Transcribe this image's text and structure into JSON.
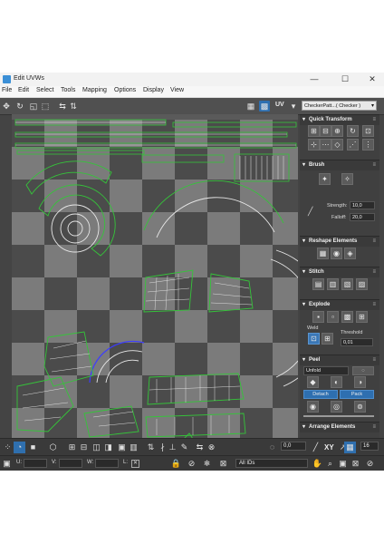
{
  "window": {
    "title": "Edit UVWs",
    "controls": {
      "minimize": "—",
      "maximize": "☐",
      "close": "✕"
    }
  },
  "menu": [
    "File",
    "Edit",
    "Select",
    "Tools",
    "Mapping",
    "Options",
    "Display",
    "View"
  ],
  "toolbar": {
    "uv_label": "UV",
    "texture_dropdown": "CheckerPatt...( Checker )"
  },
  "panels": {
    "quick_transform": {
      "title": "Quick Transform"
    },
    "brush": {
      "title": "Brush",
      "strength_label": "Strength:",
      "strength_value": "10,0",
      "falloff_label": "Falloff:",
      "falloff_value": "20,0"
    },
    "reshape": {
      "title": "Reshape Elements"
    },
    "stitch": {
      "title": "Stitch"
    },
    "explode": {
      "title": "Explode",
      "weld_label": "Weld",
      "threshold_label": "Threshold",
      "threshold_value": "0,01"
    },
    "peel": {
      "title": "Peel",
      "dropdown": "Unfold",
      "detach_label": "Detach",
      "pack_label": "Pack"
    },
    "arrange": {
      "title": "Arrange Elements"
    }
  },
  "bottom_toolbar": {
    "angle_value": "0,0",
    "xy_label": "XY",
    "grid_value": "16"
  },
  "statusbar": {
    "u_label": "U:",
    "v_label": "V:",
    "w_label": "W:",
    "l_label": "L:",
    "ids_label": "All IDs"
  },
  "colors": {
    "uv_shell_outline": "#35c43a",
    "uv_wire": "#e8e8e8",
    "selected_edge": "#3c3cff",
    "checker_dark": "#4b4b4b",
    "checker_light": "#7b7b7b",
    "accent_blue": "#2e6fb0"
  }
}
